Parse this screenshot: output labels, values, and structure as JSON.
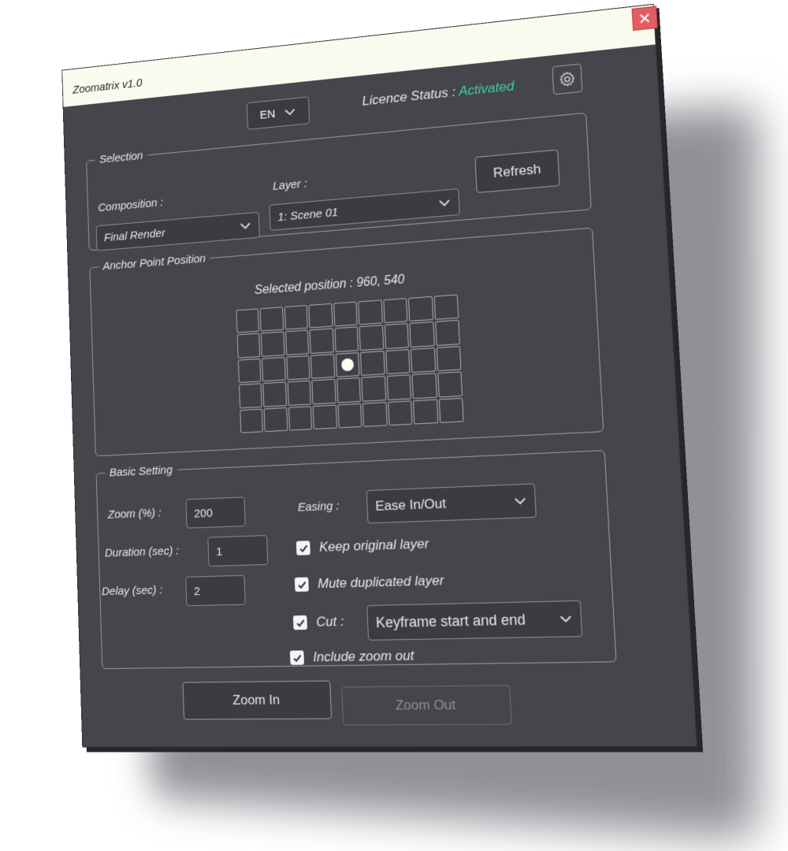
{
  "window": {
    "title": "Zoomatrix v1.0"
  },
  "header": {
    "language": "EN",
    "licence_label": "Licence Status :",
    "licence_value": "Activated",
    "licence_color": "#39d3a6"
  },
  "selection": {
    "legend": "Selection",
    "composition_label": "Composition :",
    "composition_value": "Final Render",
    "layer_label": "Layer :",
    "layer_value": "1: Scene 01",
    "refresh_label": "Refresh"
  },
  "anchor": {
    "legend": "Anchor Point Position",
    "selected_label": "Selected position  :",
    "selected_value": "960, 540",
    "grid_cols": 9,
    "grid_rows": 5,
    "selected_col": 4,
    "selected_row": 2
  },
  "basic": {
    "legend": "Basic Setting",
    "zoom_label": "Zoom (%) :",
    "zoom_value": "200",
    "duration_label": "Duration (sec) :",
    "duration_value": "1",
    "delay_label": "Delay (sec) :",
    "delay_value": "2",
    "easing_label": "Easing :",
    "easing_value": "Ease In/Out",
    "keep_original": "Keep original layer",
    "mute_duplicated": "Mute duplicated layer",
    "cut_label": "Cut :",
    "cut_value": "Keyframe start and end",
    "include_zoom_out": "Include zoom out"
  },
  "actions": {
    "zoom_in": "Zoom In",
    "zoom_out": "Zoom Out"
  }
}
